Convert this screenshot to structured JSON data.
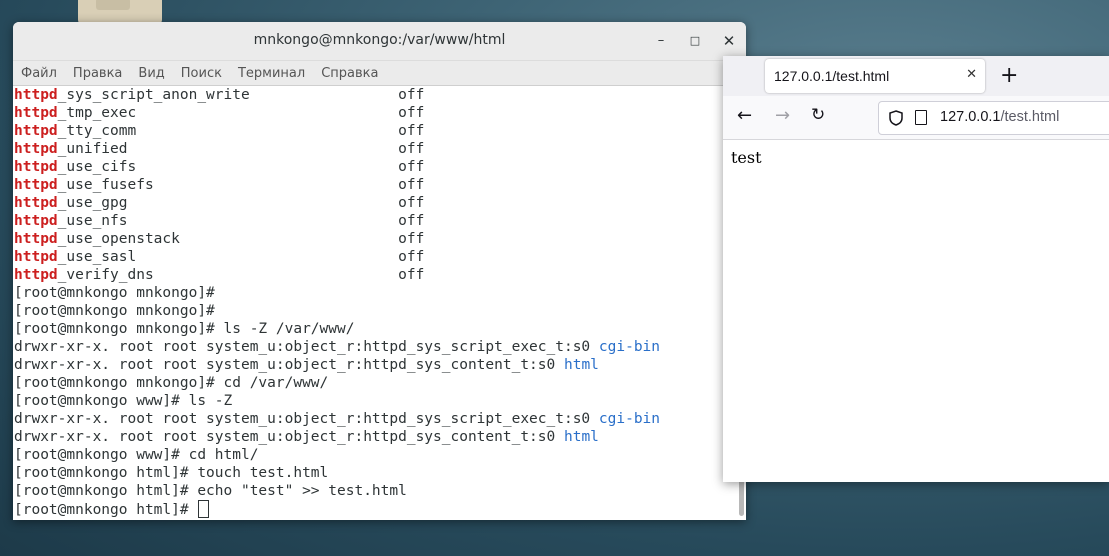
{
  "terminal": {
    "title": "mnkongo@mnkongo:/var/www/html",
    "minimize_glyph": "–",
    "maximize_glyph": "□",
    "close_glyph": "✕",
    "menu": [
      "Файл",
      "Правка",
      "Вид",
      "Поиск",
      "Терминал",
      "Справка"
    ],
    "lines": [
      {
        "prefix": "httpd",
        "text": "_sys_script_anon_write                 off"
      },
      {
        "prefix": "httpd",
        "text": "_tmp_exec                              off"
      },
      {
        "prefix": "httpd",
        "text": "_tty_comm                              off"
      },
      {
        "prefix": "httpd",
        "text": "_unified                               off"
      },
      {
        "prefix": "httpd",
        "text": "_use_cifs                              off"
      },
      {
        "prefix": "httpd",
        "text": "_use_fusefs                            off"
      },
      {
        "prefix": "httpd",
        "text": "_use_gpg                               off"
      },
      {
        "prefix": "httpd",
        "text": "_use_nfs                               off"
      },
      {
        "prefix": "httpd",
        "text": "_use_openstack                         off"
      },
      {
        "prefix": "httpd",
        "text": "_use_sasl                              off"
      },
      {
        "prefix": "httpd",
        "text": "_verify_dns                            off"
      },
      {
        "text": "[root@mnkongo mnkongo]#"
      },
      {
        "text": "[root@mnkongo mnkongo]#"
      },
      {
        "text": "[root@mnkongo mnkongo]# ls -Z /var/www/"
      },
      {
        "text": "drwxr-xr-x. root root system_u:object_r:httpd_sys_script_exec_t:s0 ",
        "suffix": "cgi-bin"
      },
      {
        "text": "drwxr-xr-x. root root system_u:object_r:httpd_sys_content_t:s0 ",
        "suffix": "html"
      },
      {
        "text": "[root@mnkongo mnkongo]# cd /var/www/"
      },
      {
        "text": "[root@mnkongo www]# ls -Z"
      },
      {
        "text": "drwxr-xr-x. root root system_u:object_r:httpd_sys_script_exec_t:s0 ",
        "suffix": "cgi-bin"
      },
      {
        "text": "drwxr-xr-x. root root system_u:object_r:httpd_sys_content_t:s0 ",
        "suffix": "html"
      },
      {
        "text": "[root@mnkongo www]# cd html/"
      },
      {
        "text": "[root@mnkongo html]# touch test.html"
      },
      {
        "text": "[root@mnkongo html]# echo \"test\" >> test.html"
      },
      {
        "text": "[root@mnkongo html]# ",
        "cursor": true
      }
    ],
    "colors": {
      "highlight": "#cc1f1f",
      "dir": "#2a6fc9"
    }
  },
  "browser": {
    "tab_title": "127.0.0.1/test.html",
    "tab_close": "✕",
    "new_tab": "+",
    "back": "←",
    "forward": "→",
    "reload": "↻",
    "url_host": "127.0.0.1",
    "url_path": "/test.html",
    "page_text": "test"
  }
}
